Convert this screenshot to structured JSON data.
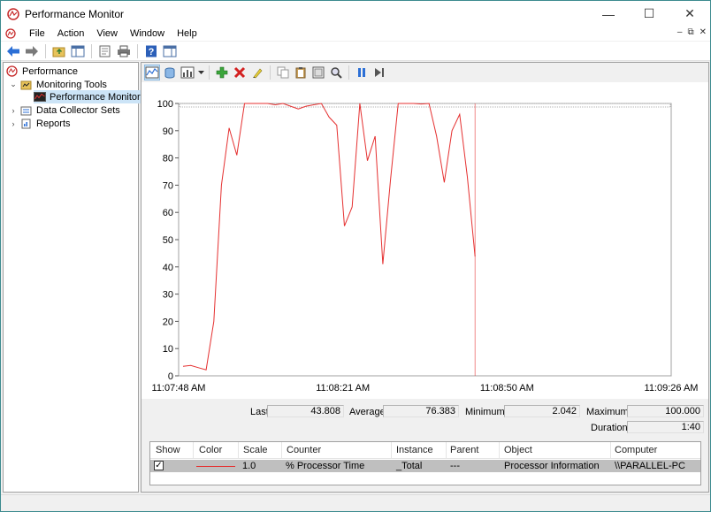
{
  "window": {
    "title": "Performance Monitor",
    "minimize_glyph": "—",
    "maximize_glyph": "☐",
    "close_glyph": "✕"
  },
  "menu": {
    "items": [
      "File",
      "Action",
      "View",
      "Window",
      "Help"
    ],
    "mdi_controls": [
      "–",
      "⧉",
      "✕"
    ]
  },
  "tree": {
    "root": "Performance",
    "monitoring_tools": "Monitoring Tools",
    "performance_monitor": "Performance Monitor",
    "data_collector_sets": "Data Collector Sets",
    "reports": "Reports",
    "expanded_glyph": "⌄",
    "collapsed_glyph": "›"
  },
  "chart_data": {
    "type": "line",
    "ylim": [
      0,
      100
    ],
    "yticks": [
      "100",
      "90",
      "80",
      "70",
      "60",
      "50",
      "40",
      "30",
      "20",
      "10",
      "0"
    ],
    "xtick_labels": [
      "11:07:48 AM",
      "11:08:21 AM",
      "11:08:50 AM",
      "11:09:26 AM"
    ],
    "series": [
      {
        "values": [
          3.5,
          3.8,
          3,
          2.2,
          20,
          70,
          91,
          81,
          100,
          100,
          100,
          100,
          99.5,
          100,
          99,
          98,
          99,
          99.5,
          100,
          95,
          92,
          55,
          62,
          100,
          79,
          88,
          41,
          72,
          100,
          100,
          100,
          99.8,
          100,
          88,
          71,
          90,
          96,
          73,
          43.8
        ]
      }
    ],
    "colors": {
      "line": "#e53030",
      "cursor": "#e53030",
      "grid": "#e0e0e0"
    }
  },
  "stats": {
    "last_label": "Last",
    "last": "43.808",
    "average_label": "Average",
    "average": "76.383",
    "minimum_label": "Minimum",
    "minimum": "2.042",
    "maximum_label": "Maximum",
    "maximum": "100.000",
    "duration_label": "Duration",
    "duration": "1:40"
  },
  "legend": {
    "headers": [
      "Show",
      "Color",
      "Scale",
      "Counter",
      "Instance",
      "Parent",
      "Object",
      "Computer"
    ],
    "row": {
      "show": "✓",
      "scale": "1.0",
      "counter": "% Processor Time",
      "instance": "_Total",
      "parent": "---",
      "object": "Processor Information",
      "computer": "\\\\PARALLEL-PC"
    }
  }
}
